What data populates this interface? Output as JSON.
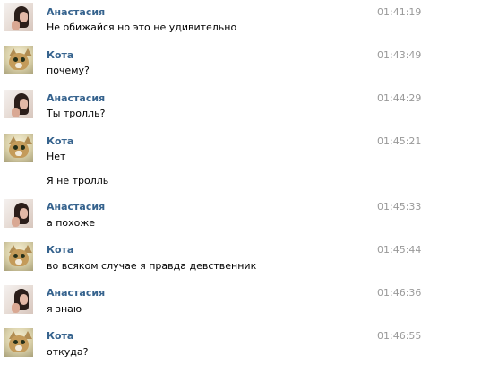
{
  "messages": [
    {
      "author": "Анастасия",
      "avatar": "girl-avatar",
      "time": "01:41:19",
      "lines": [
        "Не обижайся но это не удивительно"
      ]
    },
    {
      "author": "Кота",
      "avatar": "cat-avatar",
      "time": "01:43:49",
      "lines": [
        "почему?"
      ]
    },
    {
      "author": "Анастасия",
      "avatar": "girl-avatar",
      "time": "01:44:29",
      "lines": [
        "Ты тролль?"
      ]
    },
    {
      "author": "Кота",
      "avatar": "cat-avatar",
      "time": "01:45:21",
      "lines": [
        "Нет",
        "Я не тролль"
      ]
    },
    {
      "author": "Анастасия",
      "avatar": "girl-avatar",
      "time": "01:45:33",
      "lines": [
        "а похоже"
      ]
    },
    {
      "author": "Кота",
      "avatar": "cat-avatar",
      "time": "01:45:44",
      "lines": [
        "во всяком случае я правда девственник"
      ]
    },
    {
      "author": "Анастасия",
      "avatar": "girl-avatar",
      "time": "01:46:36",
      "lines": [
        "я знаю"
      ]
    },
    {
      "author": "Кота",
      "avatar": "cat-avatar",
      "time": "01:46:55",
      "lines": [
        "откуда?"
      ]
    }
  ],
  "colors": {
    "author_name": "#36638e",
    "timestamp": "#999999",
    "message_text": "#000000",
    "background": "#ffffff"
  }
}
